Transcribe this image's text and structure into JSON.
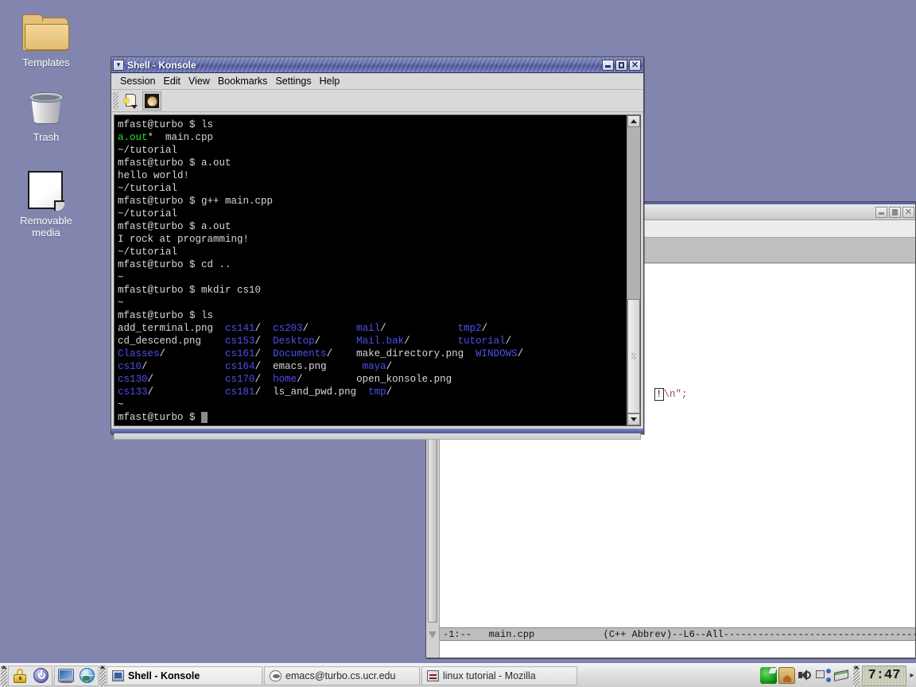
{
  "desktop": {
    "background_color": "#8286ae",
    "icons": [
      {
        "name": "Templates",
        "icon": "folder-icon"
      },
      {
        "name": "Trash",
        "icon": "trash-icon"
      },
      {
        "name": "Removable media",
        "label_line1": "Removable",
        "label_line2": "media",
        "icon": "removable-media-icon"
      }
    ]
  },
  "konsole": {
    "title": "Shell - Konsole",
    "menu": [
      "Session",
      "Edit",
      "View",
      "Bookmarks",
      "Settings",
      "Help"
    ],
    "toolbar": [
      {
        "name": "new-session-button",
        "icon": "new-session-icon"
      },
      {
        "name": "shell-session-button",
        "icon": "shell-icon"
      }
    ],
    "window_buttons": [
      "minimize",
      "maximize",
      "close"
    ],
    "terminal_lines": [
      [
        {
          "t": "mfast@turbo $ ls",
          "c": "wht"
        }
      ],
      [
        {
          "t": "a.out",
          "c": "grn"
        },
        {
          "t": "*  main.cpp",
          "c": "wht"
        }
      ],
      [
        {
          "t": "~/tutorial",
          "c": "wht"
        }
      ],
      [
        {
          "t": "mfast@turbo $ a.out",
          "c": "wht"
        }
      ],
      [
        {
          "t": "hello world!",
          "c": "wht"
        }
      ],
      [
        {
          "t": "~/tutorial",
          "c": "wht"
        }
      ],
      [
        {
          "t": "mfast@turbo $ g++ main.cpp",
          "c": "wht"
        }
      ],
      [
        {
          "t": "~/tutorial",
          "c": "wht"
        }
      ],
      [
        {
          "t": "mfast@turbo $ a.out",
          "c": "wht"
        }
      ],
      [
        {
          "t": "I rock at programming!",
          "c": "wht"
        }
      ],
      [
        {
          "t": "~/tutorial",
          "c": "wht"
        }
      ],
      [
        {
          "t": "mfast@turbo $ cd ..",
          "c": "wht"
        }
      ],
      [
        {
          "t": "~",
          "c": "wht"
        }
      ],
      [
        {
          "t": "mfast@turbo $ mkdir cs10",
          "c": "wht"
        }
      ],
      [
        {
          "t": "~",
          "c": "wht"
        }
      ],
      [
        {
          "t": "mfast@turbo $ ls",
          "c": "wht"
        }
      ],
      [
        {
          "t": "add_terminal.png  ",
          "c": "wht"
        },
        {
          "t": "cs141",
          "c": "blu"
        },
        {
          "t": "/  ",
          "c": "wht"
        },
        {
          "t": "cs203",
          "c": "blu"
        },
        {
          "t": "/        ",
          "c": "wht"
        },
        {
          "t": "mail",
          "c": "blu"
        },
        {
          "t": "/            ",
          "c": "wht"
        },
        {
          "t": "tmp2",
          "c": "blu"
        },
        {
          "t": "/",
          "c": "wht"
        }
      ],
      [
        {
          "t": "cd_descend.png    ",
          "c": "wht"
        },
        {
          "t": "cs153",
          "c": "blu"
        },
        {
          "t": "/  ",
          "c": "wht"
        },
        {
          "t": "Desktop",
          "c": "blu"
        },
        {
          "t": "/      ",
          "c": "wht"
        },
        {
          "t": "Mail.bak",
          "c": "blu"
        },
        {
          "t": "/        ",
          "c": "wht"
        },
        {
          "t": "tutorial",
          "c": "blu"
        },
        {
          "t": "/",
          "c": "wht"
        }
      ],
      [
        {
          "t": "Classes",
          "c": "blu"
        },
        {
          "t": "/          ",
          "c": "wht"
        },
        {
          "t": "cs161",
          "c": "blu"
        },
        {
          "t": "/  ",
          "c": "wht"
        },
        {
          "t": "Documents",
          "c": "blu"
        },
        {
          "t": "/    ",
          "c": "wht"
        },
        {
          "t": "make_directory.png  ",
          "c": "wht"
        },
        {
          "t": "WINDOWS",
          "c": "blu"
        },
        {
          "t": "/",
          "c": "wht"
        }
      ],
      [
        {
          "t": "cs10",
          "c": "blu"
        },
        {
          "t": "/             ",
          "c": "wht"
        },
        {
          "t": "cs164",
          "c": "blu"
        },
        {
          "t": "/  emacs.png      ",
          "c": "wht"
        },
        {
          "t": "maya",
          "c": "blu"
        },
        {
          "t": "/",
          "c": "wht"
        }
      ],
      [
        {
          "t": "cs130",
          "c": "blu"
        },
        {
          "t": "/            ",
          "c": "wht"
        },
        {
          "t": "cs170",
          "c": "blu"
        },
        {
          "t": "/  ",
          "c": "wht"
        },
        {
          "t": "home",
          "c": "blu"
        },
        {
          "t": "/         open_konsole.png",
          "c": "wht"
        }
      ],
      [
        {
          "t": "cs133",
          "c": "blu"
        },
        {
          "t": "/            ",
          "c": "wht"
        },
        {
          "t": "cs181",
          "c": "blu"
        },
        {
          "t": "/  ls_and_pwd.png  ",
          "c": "wht"
        },
        {
          "t": "tmp",
          "c": "blu"
        },
        {
          "t": "/",
          "c": "wht"
        }
      ],
      [
        {
          "t": "~",
          "c": "wht"
        }
      ],
      [
        {
          "t": "mfast@turbo $ ",
          "c": "wht"
        },
        {
          "t": " ",
          "c": "cursor"
        }
      ]
    ]
  },
  "emacs": {
    "title": "",
    "code_fragment_prefix": "!",
    "code_fragment_suffix": "\\n\";",
    "modeline": "-1:--   main.cpp            (C++ Abbrev)--L6--All------------------------------------",
    "window_buttons": [
      "minimize",
      "maximize",
      "close"
    ],
    "toolbar_icons": [
      "save-as-icon",
      "search-icon",
      "print-icon",
      "spellcheck-icon",
      "help-icon"
    ]
  },
  "taskbar": {
    "launchers": [
      {
        "name": "lock-screen-button",
        "icon": "lock-icon"
      },
      {
        "name": "logout-button",
        "icon": "power-icon"
      },
      {
        "name": "show-desktop-button",
        "icon": "screen-icon"
      },
      {
        "name": "browser-button",
        "icon": "globe-icon"
      }
    ],
    "tasks": [
      {
        "label": "Shell - Konsole",
        "icon": "konsole-icon",
        "active": true
      },
      {
        "label": "emacs@turbo.cs.ucr.edu",
        "icon": "gnu-icon",
        "active": false
      },
      {
        "label": "linux tutorial - Mozilla",
        "icon": "mozilla-icon",
        "active": false
      }
    ],
    "tray": [
      {
        "name": "klipper-icon"
      },
      {
        "name": "home-folder-icon"
      },
      {
        "name": "volume-icon"
      },
      {
        "name": "network-icon"
      },
      {
        "name": "notes-icon"
      }
    ],
    "clock": "7:47"
  }
}
